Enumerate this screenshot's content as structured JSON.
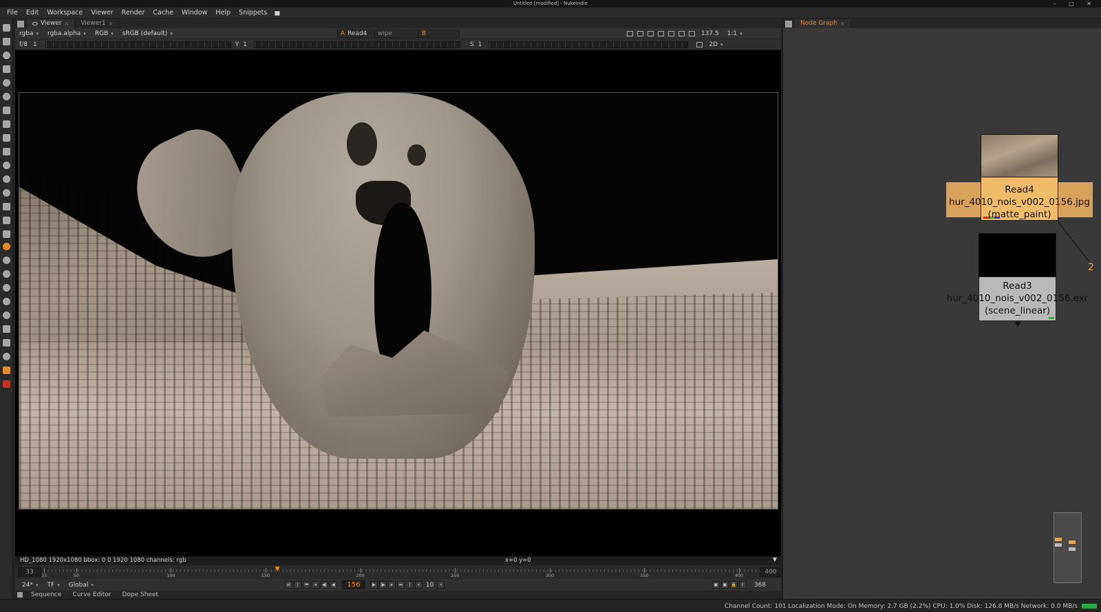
{
  "window": {
    "title": "Untitled [modified] - NukeIndie",
    "controls": "– □ ✕"
  },
  "menu": [
    "File",
    "Edit",
    "Workspace",
    "Viewer",
    "Render",
    "Cache",
    "Window",
    "Help",
    "Snippets"
  ],
  "viewer_tabs": [
    {
      "label": "Viewer",
      "active": true
    },
    {
      "label": "Viewer1",
      "active": false
    }
  ],
  "viewer_controls": {
    "channels": "rgba",
    "alpha": "rgba.alpha",
    "display_channel": "RGB",
    "colorspace": "sRGB (default)",
    "input_a_label": "A",
    "input_a": "Read4",
    "wipe": "wipe",
    "input_b_label": "B",
    "zoom": "137.5",
    "proxy": "1:1",
    "fstop": "f/8",
    "gain": "1",
    "gamma_label": "Y",
    "gamma": "1",
    "saturation_label": "S",
    "saturation": "1",
    "view_mode": "2D"
  },
  "viewer_info": {
    "format": "HD_1080 1920x1080  bbox: 0 0 1920 1080 channels: rgb",
    "coords": "x=0 y=0"
  },
  "timeline": {
    "start": "33",
    "end": "400",
    "current_frame": 156,
    "range_min": 33,
    "range_max": 400,
    "tick_labels": [
      "33",
      "50",
      "100",
      "150",
      "200",
      "250",
      "300",
      "350",
      "400"
    ],
    "fps": "24*",
    "tf": "TF",
    "scope": "Global",
    "frame_field": "156",
    "increment": "10",
    "out_frame": "368"
  },
  "bottom_tabs": [
    "Sequence",
    "Curve Editor",
    "Dope Sheet"
  ],
  "node_graph": {
    "tab": "Node Graph",
    "nodes": [
      {
        "name": "Read4",
        "file": "hur_4010_nois_v002_0156.jpg",
        "colorspace": "(matte_paint)"
      },
      {
        "name": "Read3",
        "file": "hur_4010_nois_v002_0156.exr",
        "colorspace": "(scene_linear)"
      }
    ],
    "edge_label": "2"
  },
  "status": "Channel Count: 101  Localization Mode: On  Memory: 2.7 GB (2.2%)  CPU: 1.0%  Disk: 126.8 MB/s  Network: 0.0 MB/s",
  "colors": {
    "accent": "#e38a2b",
    "read_node": "#f0bb6b",
    "read_node_dim": "#b9b9b9"
  },
  "icons": [
    "viewer-tool-icon",
    "paint-icon",
    "time-icon",
    "channel-icon",
    "color-icon",
    "filter-icon",
    "keyer-icon",
    "merge-icon",
    "transform-icon",
    "3d-icon",
    "particles-icon",
    "deep-icon",
    "views-icon",
    "metadata-icon",
    "toolsets-icon",
    "other-icon",
    "furnace-icon",
    "ocio-icon"
  ]
}
